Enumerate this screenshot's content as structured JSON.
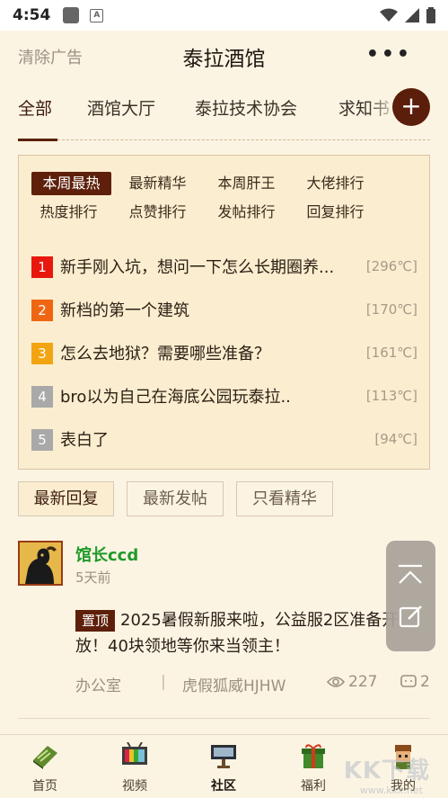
{
  "status_bar": {
    "time": "4:54"
  },
  "header": {
    "clear_ads": "清除广告",
    "title": "泰拉酒馆",
    "more": "•••"
  },
  "tabs": [
    {
      "label": "全部",
      "active": true
    },
    {
      "label": "酒馆大厅"
    },
    {
      "label": "泰拉技术协会"
    },
    {
      "label": "求知书"
    }
  ],
  "add_button": "+",
  "rank_filters": [
    {
      "label": "本周最热",
      "active": true
    },
    {
      "label": "最新精华"
    },
    {
      "label": "本周肝王"
    },
    {
      "label": "大佬排行"
    },
    {
      "label": "热度排行"
    },
    {
      "label": "点赞排行"
    },
    {
      "label": "发帖排行"
    },
    {
      "label": "回复排行"
    }
  ],
  "rank_list": [
    {
      "rank": "1",
      "title": "新手刚入坑，想问一下怎么长期圈养...",
      "heat": "[296℃]",
      "color": "#e8180f"
    },
    {
      "rank": "2",
      "title": "新档的第一个建筑",
      "heat": "[170℃]",
      "color": "#ef6612"
    },
    {
      "rank": "3",
      "title": "怎么去地狱？需要哪些准备？",
      "heat": "[161℃]",
      "color": "#f2a511"
    },
    {
      "rank": "4",
      "title": "bro以为自己在海底公园玩泰拉..",
      "heat": "[113℃]",
      "color": "#a9a9a9"
    },
    {
      "rank": "5",
      "title": "表白了",
      "heat": "[94℃]",
      "color": "#a9a9a9"
    }
  ],
  "sort_buttons": [
    {
      "label": "最新回复",
      "active": true
    },
    {
      "label": "最新发帖"
    },
    {
      "label": "只看精华"
    }
  ],
  "post": {
    "username": "馆长ccd",
    "time": "5天前",
    "badge": "置顶",
    "content": "2025暑假新服来啦，公益服2区准备开放！40块领地等你来当领主！",
    "board": "办公室",
    "author": "虎假狐威HJHW",
    "views": "227",
    "comments": "2"
  },
  "bottom_nav": [
    {
      "label": "首页"
    },
    {
      "label": "视频"
    },
    {
      "label": "社区",
      "active": true
    },
    {
      "label": "福利"
    },
    {
      "label": "我的"
    }
  ],
  "watermark": {
    "text": "KK下载",
    "url": "www.kkx.net"
  }
}
